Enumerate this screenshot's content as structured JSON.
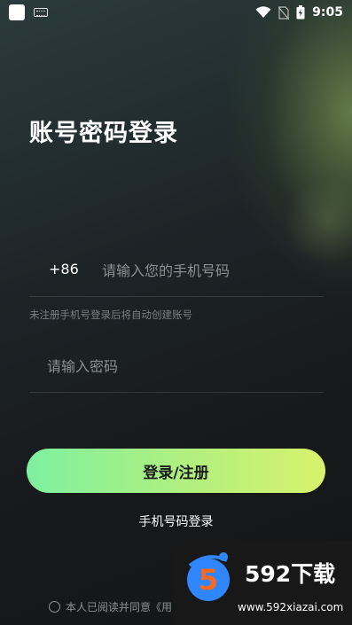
{
  "status_bar": {
    "time": "9:05"
  },
  "title": "账号密码登录",
  "phone": {
    "country_code": "+86",
    "placeholder": "请输入您的手机号码"
  },
  "hint": "未注册手机号登录后将自动创建账号",
  "password": {
    "placeholder": "请输入密码"
  },
  "login_button": "登录/注册",
  "alt_login": "手机号码登录",
  "agreement": "本人已阅读并同意《用",
  "watermark": {
    "brand": "592下载",
    "url": "www.592xiazai.com",
    "digit": "5"
  },
  "colors": {
    "button_start": "#7ef0a0",
    "button_end": "#d8f26c"
  }
}
